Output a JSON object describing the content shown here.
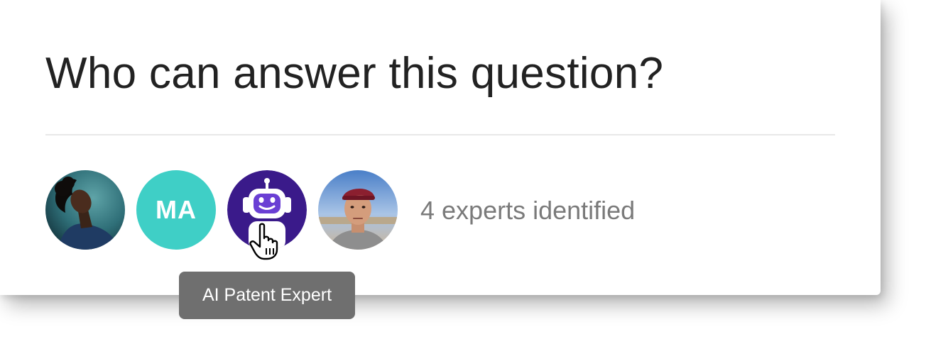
{
  "question": {
    "title": "Who can answer this question?"
  },
  "experts": {
    "items": [
      {
        "kind": "photo",
        "icon": "woman-portrait-photo"
      },
      {
        "kind": "initials",
        "initials": "MA",
        "color": "#3fcfc6"
      },
      {
        "kind": "bot",
        "icon": "robot-icon",
        "color": "#3a1a8a"
      },
      {
        "kind": "photo",
        "icon": "man-portrait-photo"
      }
    ],
    "count_label": "4 experts identified"
  },
  "tooltip": {
    "text": "AI Patent Expert"
  },
  "cursor": {
    "icon": "hand-pointer-icon"
  }
}
